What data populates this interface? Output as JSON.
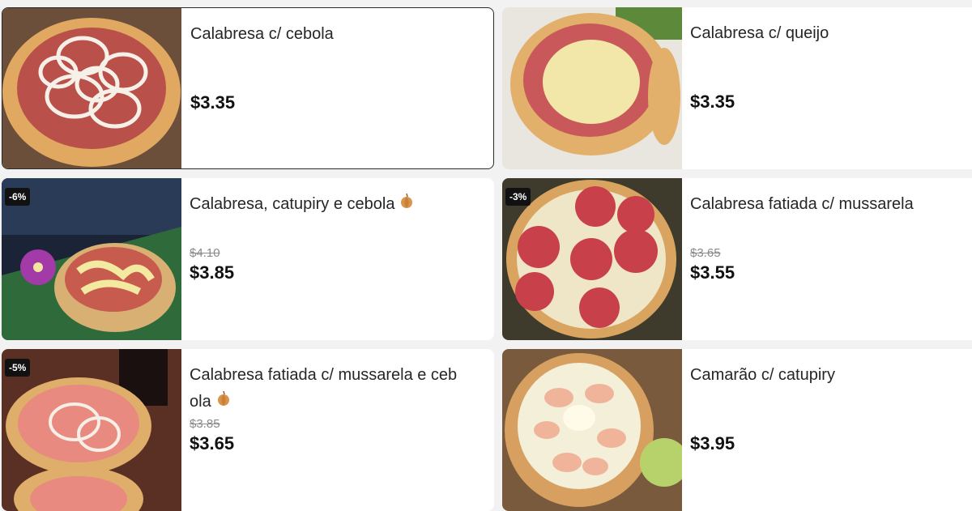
{
  "products": [
    {
      "name": "Calabresa c/ cebola",
      "price": "$3.35",
      "old_price": "",
      "discount": "",
      "emoji": ""
    },
    {
      "name": "Calabresa c/ queijo",
      "price": "$3.35",
      "old_price": "",
      "discount": "",
      "emoji": ""
    },
    {
      "name": "Calabresa, catupiry e cebola",
      "price": "$3.85",
      "old_price": "$4.10",
      "discount": "-6%",
      "emoji": "onion-icon"
    },
    {
      "name": "Calabresa fatiada c/ mussarela",
      "price": "$3.55",
      "old_price": "$3.65",
      "discount": "-3%",
      "emoji": ""
    },
    {
      "name_line1": "Calabresa fatiada c/ mussarela e ceb",
      "name_line2": "ola",
      "price": "$3.65",
      "old_price": "$3.85",
      "discount": "-5%",
      "emoji": "onion-icon"
    },
    {
      "name": "Camarão c/ catupiry",
      "price": "$3.95",
      "old_price": "",
      "discount": "",
      "emoji": ""
    }
  ]
}
